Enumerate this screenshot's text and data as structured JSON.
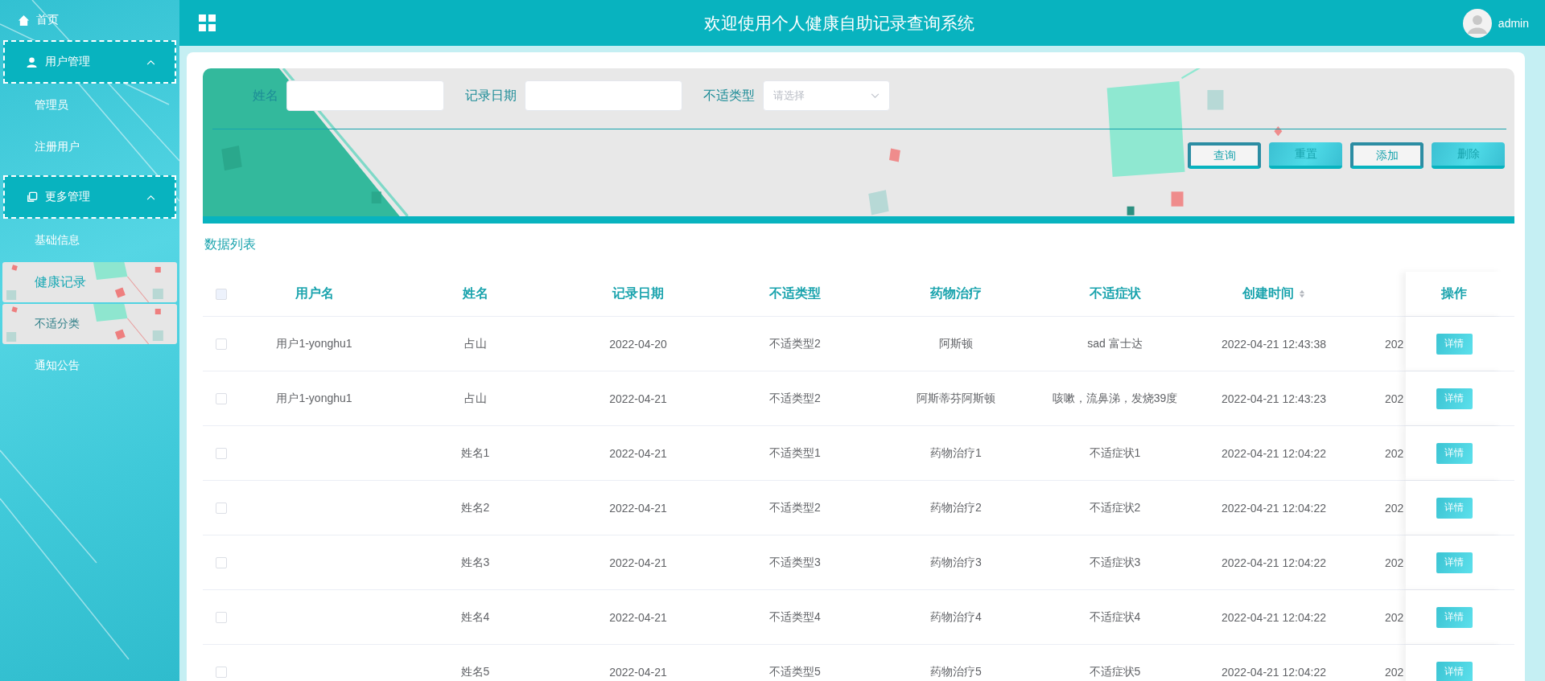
{
  "sidebar": {
    "items": [
      {
        "kind": "link",
        "label": "首页"
      },
      {
        "kind": "group",
        "label": "用户管理",
        "expanded": true,
        "children": [
          {
            "label": "管理员",
            "selected": false,
            "hovered": false
          },
          {
            "label": "注册用户",
            "selected": false,
            "hovered": false
          }
        ]
      },
      {
        "kind": "group",
        "label": "更多管理",
        "expanded": true,
        "children": [
          {
            "label": "基础信息",
            "selected": false,
            "hovered": false
          },
          {
            "label": "健康记录",
            "selected": true,
            "hovered": false
          },
          {
            "label": "不适分类",
            "selected": false,
            "hovered": true
          },
          {
            "label": "通知公告",
            "selected": false,
            "hovered": false
          }
        ]
      }
    ]
  },
  "header": {
    "title": "欢迎使用个人健康自助记录查询系统",
    "user": "admin"
  },
  "search": {
    "fields": [
      {
        "kind": "input",
        "label": "姓名"
      },
      {
        "kind": "input",
        "label": "记录日期"
      },
      {
        "kind": "select",
        "label": "不适类型",
        "placeholder": "请选择"
      }
    ],
    "buttons": [
      {
        "kind": "outline",
        "label": "查询"
      },
      {
        "kind": "filled",
        "label": "重置"
      },
      {
        "kind": "outline",
        "label": "添加"
      },
      {
        "kind": "filled",
        "label": "删除"
      }
    ]
  },
  "table": {
    "title": "数据列表",
    "all_checked": false,
    "columns": [
      {
        "label": "用户名",
        "sortable": false
      },
      {
        "label": "姓名",
        "sortable": false
      },
      {
        "label": "记录日期",
        "sortable": false
      },
      {
        "label": "不适类型",
        "sortable": false
      },
      {
        "label": "药物治疗",
        "sortable": false
      },
      {
        "label": "不适症状",
        "sortable": false
      },
      {
        "label": "创建时间",
        "sortable": true
      }
    ],
    "action_column": "操作",
    "rows": [
      {
        "checked": false,
        "cells": [
          "用户1-yonghu1",
          "占山",
          "2022-04-20",
          "不适类型2",
          "阿斯顿",
          "sad 富士达",
          "2022-04-21 12:43:38"
        ],
        "column_8": "202",
        "action": "详情"
      },
      {
        "checked": false,
        "cells": [
          "用户1-yonghu1",
          "占山",
          "2022-04-21",
          "不适类型2",
          "阿斯蒂芬阿斯顿",
          "咳嗽，流鼻涕，发烧39度",
          "2022-04-21 12:43:23"
        ],
        "column_8": "202",
        "action": "详情"
      },
      {
        "checked": false,
        "cells": [
          "",
          "姓名1",
          "2022-04-21",
          "不适类型1",
          "药物治疗1",
          "不适症状1",
          "2022-04-21 12:04:22"
        ],
        "column_8": "202",
        "action": "详情"
      },
      {
        "checked": false,
        "cells": [
          "",
          "姓名2",
          "2022-04-21",
          "不适类型2",
          "药物治疗2",
          "不适症状2",
          "2022-04-21 12:04:22"
        ],
        "column_8": "202",
        "action": "详情"
      },
      {
        "checked": false,
        "cells": [
          "",
          "姓名3",
          "2022-04-21",
          "不适类型3",
          "药物治疗3",
          "不适症状3",
          "2022-04-21 12:04:22"
        ],
        "column_8": "202",
        "action": "详情"
      },
      {
        "checked": false,
        "cells": [
          "",
          "姓名4",
          "2022-04-21",
          "不适类型4",
          "药物治疗4",
          "不适症状4",
          "2022-04-21 12:04:22"
        ],
        "column_8": "202",
        "action": "详情"
      },
      {
        "checked": false,
        "cells": [
          "",
          "姓名5",
          "2022-04-21",
          "不适类型5",
          "药物治疗5",
          "不适症状5",
          "2022-04-21 12:04:22"
        ],
        "column_8": "202",
        "action": "详情"
      }
    ]
  }
}
